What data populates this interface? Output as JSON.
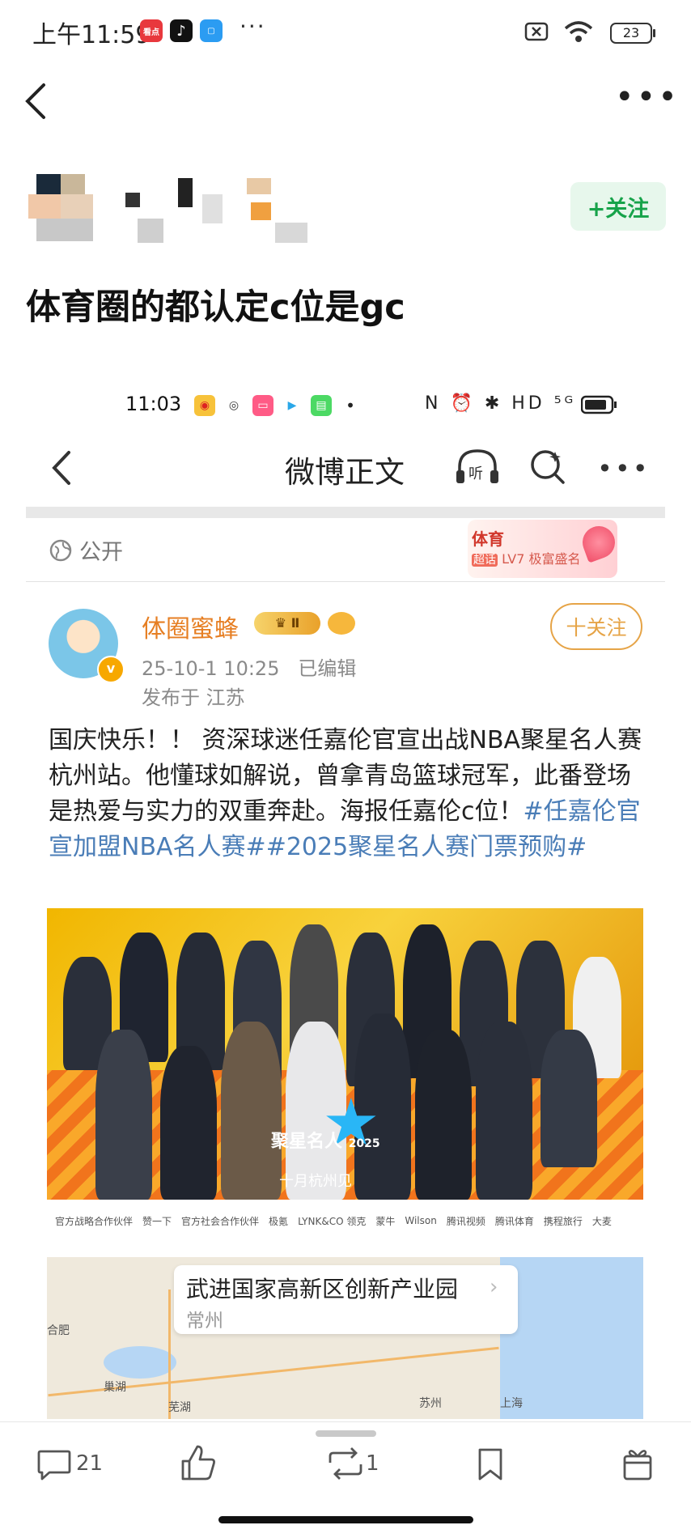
{
  "status_bar": {
    "time": "上午11:59",
    "app_badge_1": "看点",
    "battery": "23"
  },
  "post": {
    "title": "体育圈的都认定c位是gc",
    "follow_label": "+关注"
  },
  "inner": {
    "time": "11:03",
    "right_icons": "N ⏰ ✱ HD ⁵ᴳ",
    "page_title": "微博正文",
    "public_label": "公开",
    "vip_top": "体育",
    "vip_tag": "超话",
    "vip_bottom": "LV7 极富盛名",
    "username": "体圈蜜蜂",
    "rank": "Ⅱ",
    "date": "25-10-1 10:25",
    "edited": "已编辑",
    "location": "发布于 江苏",
    "follow_label": "十关注",
    "body_plain": "国庆快乐！！ 资深球迷任嘉伦官宣出战NBA聚星名人赛杭州站。他懂球如解说，曾拿青岛篮球冠军，此番登场是热爱与实力的双重奔赴。海报任嘉伦c位！",
    "hashtag_1": "#任嘉伦官宣加盟NBA名人赛#",
    "hashtag_2": "#2025聚星名人赛门票预购#",
    "poster_logo": "聚星名人",
    "poster_year": "2025",
    "poster_sub": "十月杭州见",
    "sponsors": [
      "官方战略合作伙伴",
      "赞一下",
      "官方社会合作伙伴",
      "极氪",
      "LYNK&CO 领克",
      "蒙牛",
      "Wilson",
      "腾讯视频",
      "腾讯体育",
      "携程旅行",
      "大麦"
    ],
    "map_title": "武进国家高新区创新产业园",
    "map_sub": "常州",
    "map_labels": [
      "合肥",
      "巢湖",
      "芜湖",
      "上海",
      "苏州"
    ]
  },
  "toolbar": {
    "comments": "21",
    "reposts": "1"
  },
  "colors": {
    "accent_green": "#17a34a",
    "username_orange": "#e67e22",
    "hashtag_blue": "#4a7db7"
  }
}
